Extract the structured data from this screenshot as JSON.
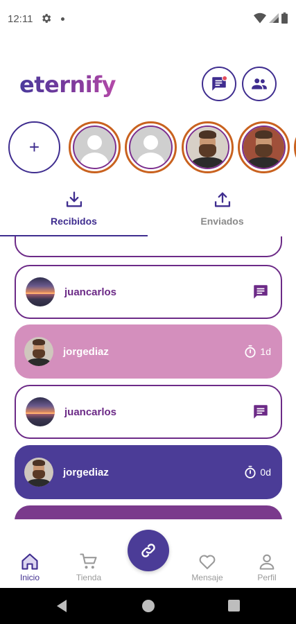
{
  "status_bar": {
    "time": "12:11"
  },
  "header": {
    "logo": "eternify"
  },
  "stories": {
    "add_label": "+"
  },
  "tabs": [
    {
      "label": "Recibidos",
      "active": true
    },
    {
      "label": "Enviados",
      "active": false
    }
  ],
  "items": [
    {
      "username": "juancarlos",
      "style": "outline",
      "avatar": "sunset",
      "trailing": "message"
    },
    {
      "username": "jorgediaz",
      "style": "pink",
      "avatar": "bearded-man",
      "trailing": "timer",
      "time": "1d"
    },
    {
      "username": "juancarlos",
      "style": "outline",
      "avatar": "sunset",
      "trailing": "message"
    },
    {
      "username": "jorgediaz",
      "style": "indigo",
      "avatar": "bearded-man",
      "trailing": "timer",
      "time": "0d"
    }
  ],
  "bottom_nav": [
    {
      "label": "Inicio",
      "icon": "home-icon",
      "active": true
    },
    {
      "label": "Tienda",
      "icon": "cart-icon",
      "active": false
    },
    {
      "label": "Mensaje",
      "icon": "heart-icon",
      "active": false
    },
    {
      "label": "Perfil",
      "icon": "person-icon",
      "active": false
    }
  ],
  "colors": {
    "primary": "#3f2d8f",
    "accent_purple": "#6c2a87",
    "pink": "#d48fbd",
    "indigo": "#4b3c97",
    "story_ring": "#c9621f"
  }
}
